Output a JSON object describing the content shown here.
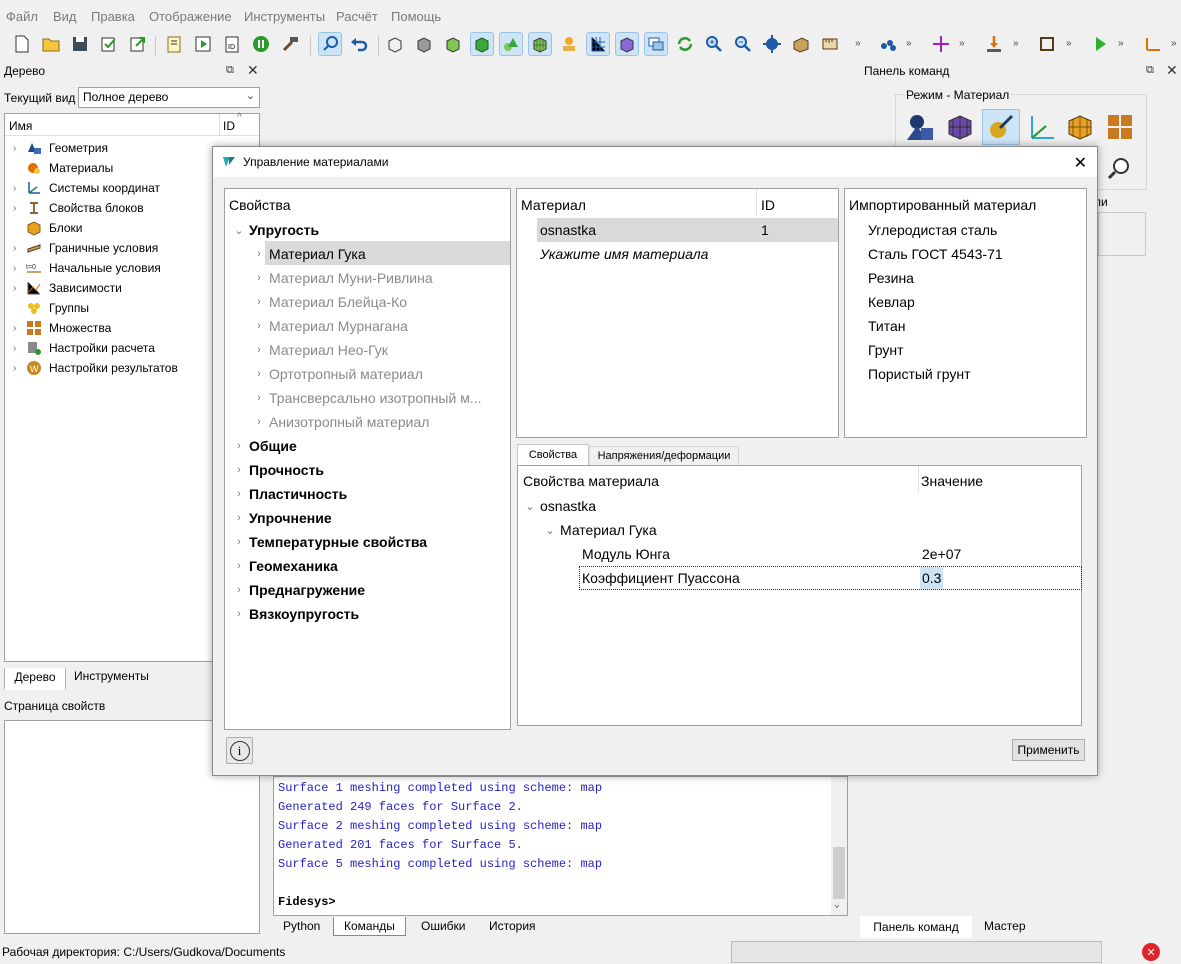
{
  "menu": [
    "Файл",
    "Вид",
    "Правка",
    "Отображение",
    "Инструменты",
    "Расчёт",
    "Помощь"
  ],
  "left_dock": {
    "title": "Дерево",
    "current_view_label": "Текущий вид",
    "current_view_value": "Полное дерево",
    "col_name": "Имя",
    "col_id": "ID",
    "items": [
      "Геометрия",
      "Материалы",
      "Системы координат",
      "Свойства блоков",
      "Блоки",
      "Граничные условия",
      "Начальные условия",
      "Зависимости",
      "Группы",
      "Множества",
      "Настройки расчета",
      "Настройки результатов"
    ],
    "tabs": [
      "Дерево",
      "Инструменты"
    ],
    "props_title": "Страница свойств"
  },
  "right_dock": {
    "title": "Панель команд",
    "mode_label": "Режим - Материал",
    "tabs": [
      "Панель команд",
      "Мастер"
    ],
    "partial_label": "ли"
  },
  "dialog": {
    "title": "Управление материалами",
    "props_header": "Свойства",
    "groups": [
      {
        "label": "Упругость",
        "expanded": true,
        "children": [
          "Материал Гука",
          "Материал Муни-Ривлина",
          "Материал Блейца-Ко",
          "Материал Мурнагана",
          "Материал Нео-Гук",
          "Ортотропный материал",
          "Трансверсально изотропный м...",
          "Анизотропный материал"
        ]
      },
      {
        "label": "Общие"
      },
      {
        "label": "Прочность"
      },
      {
        "label": "Пластичность"
      },
      {
        "label": "Упрочнение"
      },
      {
        "label": "Температурные свойства"
      },
      {
        "label": "Геомеханика"
      },
      {
        "label": "Преднагружение"
      },
      {
        "label": "Вязкоупругость"
      }
    ],
    "material_header": "Материал",
    "id_header": "ID",
    "materials": [
      {
        "name": "osnastka",
        "id": "1"
      }
    ],
    "new_material_placeholder": "Укажите имя материала",
    "imported_header": "Импортированный материал",
    "imported": [
      "Углеродистая сталь",
      "Сталь ГОСТ 4543-71",
      "Резина",
      "Кевлар",
      "Титан",
      "Грунт",
      "Пористый грунт"
    ],
    "tabs": [
      "Свойства",
      "Напряжения/деформации"
    ],
    "prop_col": "Свойства материала",
    "val_col": "Значение",
    "tree": {
      "material": "osnastka",
      "model": "Материал Гука",
      "props": [
        {
          "name": "Модуль Юнга",
          "value": "2e+07"
        },
        {
          "name": "Коэффициент Пуассона",
          "value": "0.3"
        }
      ]
    },
    "info_icon": "info-icon",
    "apply_label": "Применить"
  },
  "console": {
    "lines": [
      "Surface 1 meshing completed using scheme: map",
      "Generated 249 faces for Surface 2.",
      "Surface 2 meshing completed using scheme: map",
      "Generated 201 faces for Surface 5.",
      "Surface 5 meshing completed using scheme: map"
    ],
    "prompt": "Fidesys>",
    "tabs": [
      "Python",
      "Команды",
      "Ошибки",
      "История"
    ]
  },
  "status": {
    "workdir": "Рабочая директория: C:/Users/Gudkova/Documents"
  },
  "colors": {
    "accent": "#cde4f7",
    "selected_row": "#d9d9d9",
    "console_text": "#2323c8",
    "error": "#e0242d"
  }
}
